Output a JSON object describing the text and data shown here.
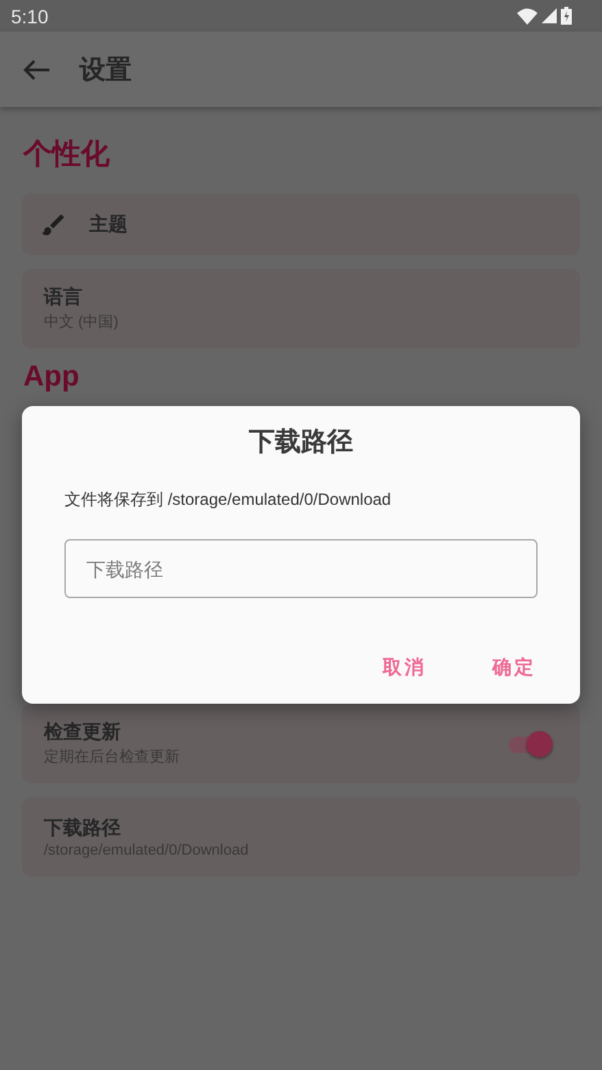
{
  "status_bar": {
    "time": "5:10"
  },
  "app_bar": {
    "title": "设置"
  },
  "sections": [
    {
      "header": "个性化",
      "items": [
        {
          "kind": "icon",
          "title": "主题"
        },
        {
          "kind": "text",
          "title": "语言",
          "subtitle": "中文 (中国)"
        }
      ]
    },
    {
      "header": "App",
      "items": [
        {
          "kind": "switch",
          "title": "检查更新",
          "subtitle": "定期在后台检查更新",
          "on": true
        },
        {
          "kind": "text",
          "title": "下载路径",
          "subtitle": "/storage/emulated/0/Download"
        }
      ]
    }
  ],
  "dialog": {
    "title": "下载路径",
    "message": "文件将保存到 /storage/emulated/0/Download",
    "field": {
      "placeholder": "下载路径"
    },
    "buttons": [
      "取消",
      "确定"
    ]
  }
}
